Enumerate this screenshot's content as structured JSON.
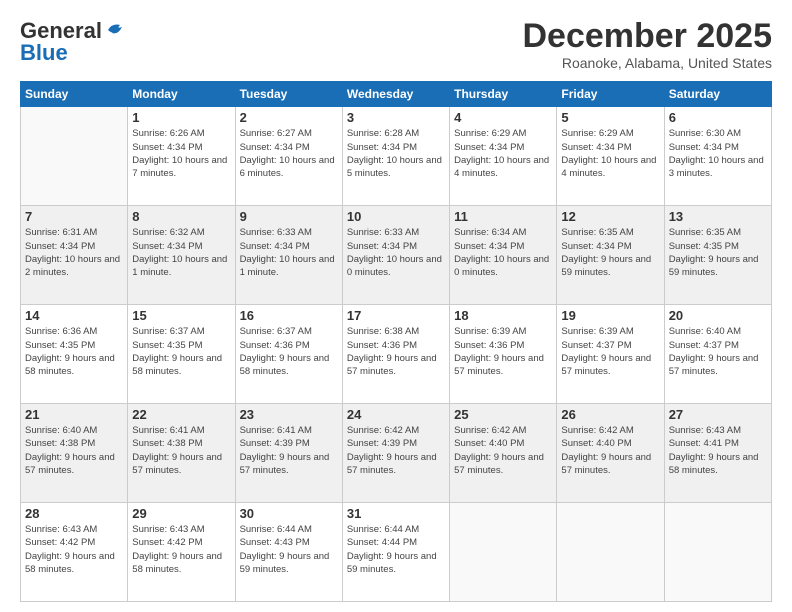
{
  "logo": {
    "general": "General",
    "blue": "Blue"
  },
  "title": "December 2025",
  "location": "Roanoke, Alabama, United States",
  "weekdays": [
    "Sunday",
    "Monday",
    "Tuesday",
    "Wednesday",
    "Thursday",
    "Friday",
    "Saturday"
  ],
  "weeks": [
    [
      {
        "day": "",
        "sunrise": "",
        "sunset": "",
        "daylight": ""
      },
      {
        "day": "1",
        "sunrise": "Sunrise: 6:26 AM",
        "sunset": "Sunset: 4:34 PM",
        "daylight": "Daylight: 10 hours and 7 minutes."
      },
      {
        "day": "2",
        "sunrise": "Sunrise: 6:27 AM",
        "sunset": "Sunset: 4:34 PM",
        "daylight": "Daylight: 10 hours and 6 minutes."
      },
      {
        "day": "3",
        "sunrise": "Sunrise: 6:28 AM",
        "sunset": "Sunset: 4:34 PM",
        "daylight": "Daylight: 10 hours and 5 minutes."
      },
      {
        "day": "4",
        "sunrise": "Sunrise: 6:29 AM",
        "sunset": "Sunset: 4:34 PM",
        "daylight": "Daylight: 10 hours and 4 minutes."
      },
      {
        "day": "5",
        "sunrise": "Sunrise: 6:29 AM",
        "sunset": "Sunset: 4:34 PM",
        "daylight": "Daylight: 10 hours and 4 minutes."
      },
      {
        "day": "6",
        "sunrise": "Sunrise: 6:30 AM",
        "sunset": "Sunset: 4:34 PM",
        "daylight": "Daylight: 10 hours and 3 minutes."
      }
    ],
    [
      {
        "day": "7",
        "sunrise": "Sunrise: 6:31 AM",
        "sunset": "Sunset: 4:34 PM",
        "daylight": "Daylight: 10 hours and 2 minutes."
      },
      {
        "day": "8",
        "sunrise": "Sunrise: 6:32 AM",
        "sunset": "Sunset: 4:34 PM",
        "daylight": "Daylight: 10 hours and 1 minute."
      },
      {
        "day": "9",
        "sunrise": "Sunrise: 6:33 AM",
        "sunset": "Sunset: 4:34 PM",
        "daylight": "Daylight: 10 hours and 1 minute."
      },
      {
        "day": "10",
        "sunrise": "Sunrise: 6:33 AM",
        "sunset": "Sunset: 4:34 PM",
        "daylight": "Daylight: 10 hours and 0 minutes."
      },
      {
        "day": "11",
        "sunrise": "Sunrise: 6:34 AM",
        "sunset": "Sunset: 4:34 PM",
        "daylight": "Daylight: 10 hours and 0 minutes."
      },
      {
        "day": "12",
        "sunrise": "Sunrise: 6:35 AM",
        "sunset": "Sunset: 4:34 PM",
        "daylight": "Daylight: 9 hours and 59 minutes."
      },
      {
        "day": "13",
        "sunrise": "Sunrise: 6:35 AM",
        "sunset": "Sunset: 4:35 PM",
        "daylight": "Daylight: 9 hours and 59 minutes."
      }
    ],
    [
      {
        "day": "14",
        "sunrise": "Sunrise: 6:36 AM",
        "sunset": "Sunset: 4:35 PM",
        "daylight": "Daylight: 9 hours and 58 minutes."
      },
      {
        "day": "15",
        "sunrise": "Sunrise: 6:37 AM",
        "sunset": "Sunset: 4:35 PM",
        "daylight": "Daylight: 9 hours and 58 minutes."
      },
      {
        "day": "16",
        "sunrise": "Sunrise: 6:37 AM",
        "sunset": "Sunset: 4:36 PM",
        "daylight": "Daylight: 9 hours and 58 minutes."
      },
      {
        "day": "17",
        "sunrise": "Sunrise: 6:38 AM",
        "sunset": "Sunset: 4:36 PM",
        "daylight": "Daylight: 9 hours and 57 minutes."
      },
      {
        "day": "18",
        "sunrise": "Sunrise: 6:39 AM",
        "sunset": "Sunset: 4:36 PM",
        "daylight": "Daylight: 9 hours and 57 minutes."
      },
      {
        "day": "19",
        "sunrise": "Sunrise: 6:39 AM",
        "sunset": "Sunset: 4:37 PM",
        "daylight": "Daylight: 9 hours and 57 minutes."
      },
      {
        "day": "20",
        "sunrise": "Sunrise: 6:40 AM",
        "sunset": "Sunset: 4:37 PM",
        "daylight": "Daylight: 9 hours and 57 minutes."
      }
    ],
    [
      {
        "day": "21",
        "sunrise": "Sunrise: 6:40 AM",
        "sunset": "Sunset: 4:38 PM",
        "daylight": "Daylight: 9 hours and 57 minutes."
      },
      {
        "day": "22",
        "sunrise": "Sunrise: 6:41 AM",
        "sunset": "Sunset: 4:38 PM",
        "daylight": "Daylight: 9 hours and 57 minutes."
      },
      {
        "day": "23",
        "sunrise": "Sunrise: 6:41 AM",
        "sunset": "Sunset: 4:39 PM",
        "daylight": "Daylight: 9 hours and 57 minutes."
      },
      {
        "day": "24",
        "sunrise": "Sunrise: 6:42 AM",
        "sunset": "Sunset: 4:39 PM",
        "daylight": "Daylight: 9 hours and 57 minutes."
      },
      {
        "day": "25",
        "sunrise": "Sunrise: 6:42 AM",
        "sunset": "Sunset: 4:40 PM",
        "daylight": "Daylight: 9 hours and 57 minutes."
      },
      {
        "day": "26",
        "sunrise": "Sunrise: 6:42 AM",
        "sunset": "Sunset: 4:40 PM",
        "daylight": "Daylight: 9 hours and 57 minutes."
      },
      {
        "day": "27",
        "sunrise": "Sunrise: 6:43 AM",
        "sunset": "Sunset: 4:41 PM",
        "daylight": "Daylight: 9 hours and 58 minutes."
      }
    ],
    [
      {
        "day": "28",
        "sunrise": "Sunrise: 6:43 AM",
        "sunset": "Sunset: 4:42 PM",
        "daylight": "Daylight: 9 hours and 58 minutes."
      },
      {
        "day": "29",
        "sunrise": "Sunrise: 6:43 AM",
        "sunset": "Sunset: 4:42 PM",
        "daylight": "Daylight: 9 hours and 58 minutes."
      },
      {
        "day": "30",
        "sunrise": "Sunrise: 6:44 AM",
        "sunset": "Sunset: 4:43 PM",
        "daylight": "Daylight: 9 hours and 59 minutes."
      },
      {
        "day": "31",
        "sunrise": "Sunrise: 6:44 AM",
        "sunset": "Sunset: 4:44 PM",
        "daylight": "Daylight: 9 hours and 59 minutes."
      },
      {
        "day": "",
        "sunrise": "",
        "sunset": "",
        "daylight": ""
      },
      {
        "day": "",
        "sunrise": "",
        "sunset": "",
        "daylight": ""
      },
      {
        "day": "",
        "sunrise": "",
        "sunset": "",
        "daylight": ""
      }
    ]
  ]
}
